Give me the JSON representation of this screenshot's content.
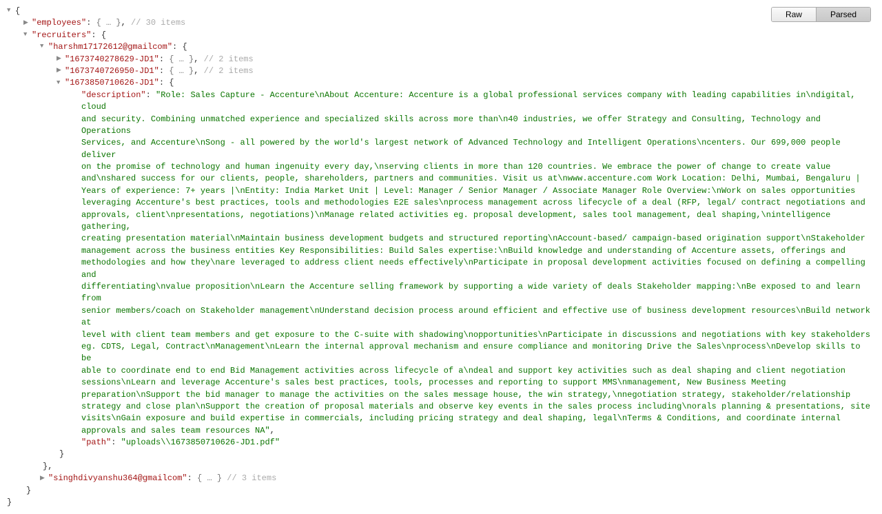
{
  "buttons": {
    "raw": "Raw",
    "parsed": "Parsed"
  },
  "tree": {
    "open_brace": "{",
    "close_brace": "}",
    "employees_key": "\"employees\"",
    "employees_collapsed": "{ … }",
    "employees_comment": "// 30 items",
    "recruiters_key": "\"recruiters\"",
    "recruiter1_key": "\"harshm17172612@gmailcom\"",
    "jd1_key": "\"1673740278629-JD1\"",
    "jd1_collapsed": "{ … }",
    "jd1_comment": "// 2 items",
    "jd2_key": "\"1673740726950-JD1\"",
    "jd2_collapsed": "{ … }",
    "jd2_comment": "// 2 items",
    "jd3_key": "\"1673850710626-JD1\"",
    "desc_key": "\"description\"",
    "desc_start": "\"Role: Sales Capture - Accenture\\nAbout Accenture: Accenture is a global professional services company with leading capabilities in\\ndigital, cloud",
    "desc_l2": "and security. Combining unmatched experience and specialized skills across more than\\n40 industries, we offer Strategy and Consulting, Technology and Operations",
    "desc_l3": "Services, and Accenture\\nSong - all powered by the world's largest network of Advanced Technology and Intelligent Operations\\ncenters. Our 699,000 people deliver",
    "desc_l4": "on the promise of technology and human ingenuity every day,\\nserving clients in more than 120 countries. We embrace the power of change to create value",
    "desc_l5": "and\\nshared success for our clients, people, shareholders, partners and communities. Visit us at\\nwww.accenture.com Work Location: Delhi, Mumbai, Bengaluru |",
    "desc_l6": "Years of experience: 7+ years |\\nEntity: India Market Unit | Level: Manager / Senior Manager / Associate Manager Role Overview:\\nWork on sales opportunities",
    "desc_l7": "leveraging Accenture's best practices, tools and methodologies E2E sales\\nprocess management across lifecycle of a deal (RFP, legal/ contract negotiations and",
    "desc_l8": "approvals, client\\npresentations, negotiations)\\nManage related activities eg. proposal development, sales tool management, deal shaping,\\nintelligence gathering,",
    "desc_l9": "creating presentation material\\nMaintain business development budgets and structured reporting\\nAccount-based/ campaign-based origination support\\nStakeholder",
    "desc_l10": "management across the business entities Key Responsibilities: Build Sales expertise:\\nBuild knowledge and understanding of Accenture assets, offerings and",
    "desc_l11": "methodologies and how they\\nare leveraged to address client needs effectively\\nParticipate in proposal development activities focused on defining a compelling and",
    "desc_l12": "differentiating\\nvalue proposition\\nLearn the Accenture selling framework by supporting a wide variety of deals Stakeholder mapping:\\nBe exposed to and learn from",
    "desc_l13": "senior members/coach on Stakeholder management\\nUnderstand decision process around efficient and effective use of business development resources\\nBuild network at",
    "desc_l14": "level with client team members and get exposure to the C-suite with shadowing\\nopportunities\\nParticipate in discussions and negotiations with key stakeholders",
    "desc_l15": "eg. CDTS, Legal, Contract\\nManagement\\nLearn the internal approval mechanism and ensure compliance and monitoring Drive the Sales\\nprocess\\nDevelop skills to be",
    "desc_l16": "able to coordinate end to end Bid Management activities across lifecycle of a\\ndeal and support key activities such as deal shaping and client negotiation",
    "desc_l17": "sessions\\nLearn and leverage Accenture's sales best practices, tools, processes and reporting to support MMS\\nmanagement, New Business Meeting",
    "desc_l18": "preparation\\nSupport the bid manager to manage the activities on the sales message house, the win strategy,\\nnegotiation strategy, stakeholder/relationship",
    "desc_l19": "strategy and close plan\\nSupport the creation of proposal materials and observe key events in the sales process including\\norals planning & presentations, site",
    "desc_l20": "visits\\nGain exposure and build expertise in commercials, including pricing strategy and deal shaping, legal\\nTerms & Conditions, and coordinate internal",
    "desc_l21": "approvals and sales team resources NA\"",
    "path_key": "\"path\"",
    "path_val": "\"uploads\\\\1673850710626-JD1.pdf\"",
    "recruiter2_key": "\"singhdivyanshu364@gmailcom\"",
    "recruiter2_collapsed": "{ … }",
    "recruiter2_comment": "// 3 items",
    "comma": ",",
    "colon": ": "
  }
}
